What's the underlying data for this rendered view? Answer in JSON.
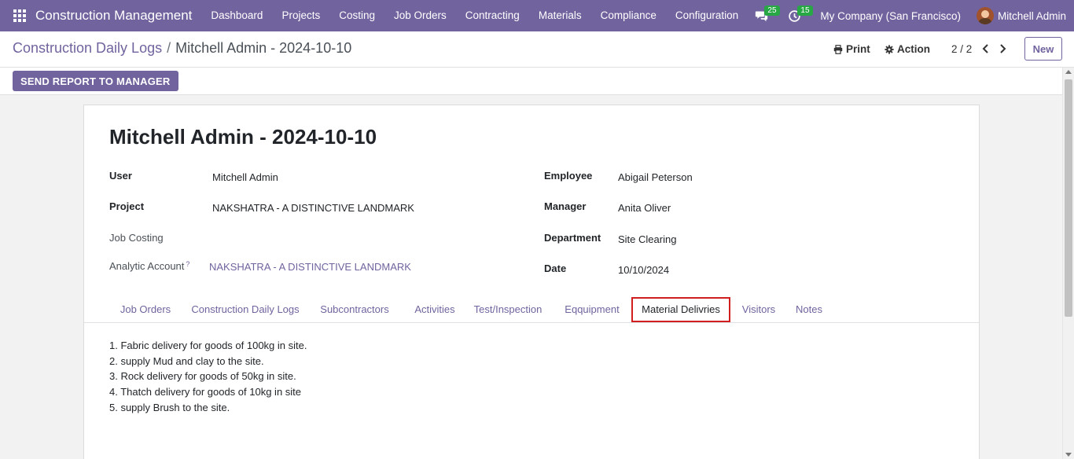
{
  "navbar": {
    "brand": "Construction Management",
    "menu": [
      "Dashboard",
      "Projects",
      "Costing",
      "Job Orders",
      "Contracting",
      "Materials",
      "Compliance",
      "Configuration"
    ],
    "messages_count": "25",
    "activities_count": "15",
    "company": "My Company (San Francisco)",
    "user": "Mitchell Admin",
    "bg_color": "#71639e"
  },
  "breadcrumb": {
    "parent": "Construction Daily Logs",
    "separator": "/",
    "current": "Mitchell Admin - 2024-10-10"
  },
  "control": {
    "print_label": "Print",
    "action_label": "Action",
    "pager": "2 / 2",
    "new_label": "New"
  },
  "statusbar": {
    "send_label": "SEND REPORT TO MANAGER"
  },
  "record": {
    "title": "Mitchell Admin - 2024-10-10",
    "fields": {
      "user_label": "User",
      "user_value": "Mitchell Admin",
      "project_label": "Project",
      "project_value": "NAKSHATRA - A DISTINCTIVE LANDMARK",
      "job_costing_label": "Job Costing",
      "analytic_label": "Analytic Account",
      "analytic_help": "?",
      "analytic_value": "NAKSHATRA - A DISTINCTIVE LANDMARK",
      "employee_label": "Employee",
      "employee_value": "Abigail Peterson",
      "manager_label": "Manager",
      "manager_value": "Anita Oliver",
      "department_label": "Department",
      "department_value": "Site Clearing",
      "date_label": "Date",
      "date_value": "10/10/2024"
    }
  },
  "tabs": [
    "Job Orders",
    "Construction Daily Logs",
    "Subcontractors",
    "Activities",
    "Test/Inspection",
    "Eqquipment",
    "Material Delivries",
    "Visitors",
    "Notes"
  ],
  "active_tab": "Material Delivries",
  "material_deliveries": [
    "1. Fabric delivery for goods of 100kg in site.",
    "2. supply Mud and clay to the site.",
    "3. Rock delivery for goods of 50kg in site.",
    "4. Thatch delivery for goods of 10kg in site",
    "5. supply Brush to the site."
  ]
}
